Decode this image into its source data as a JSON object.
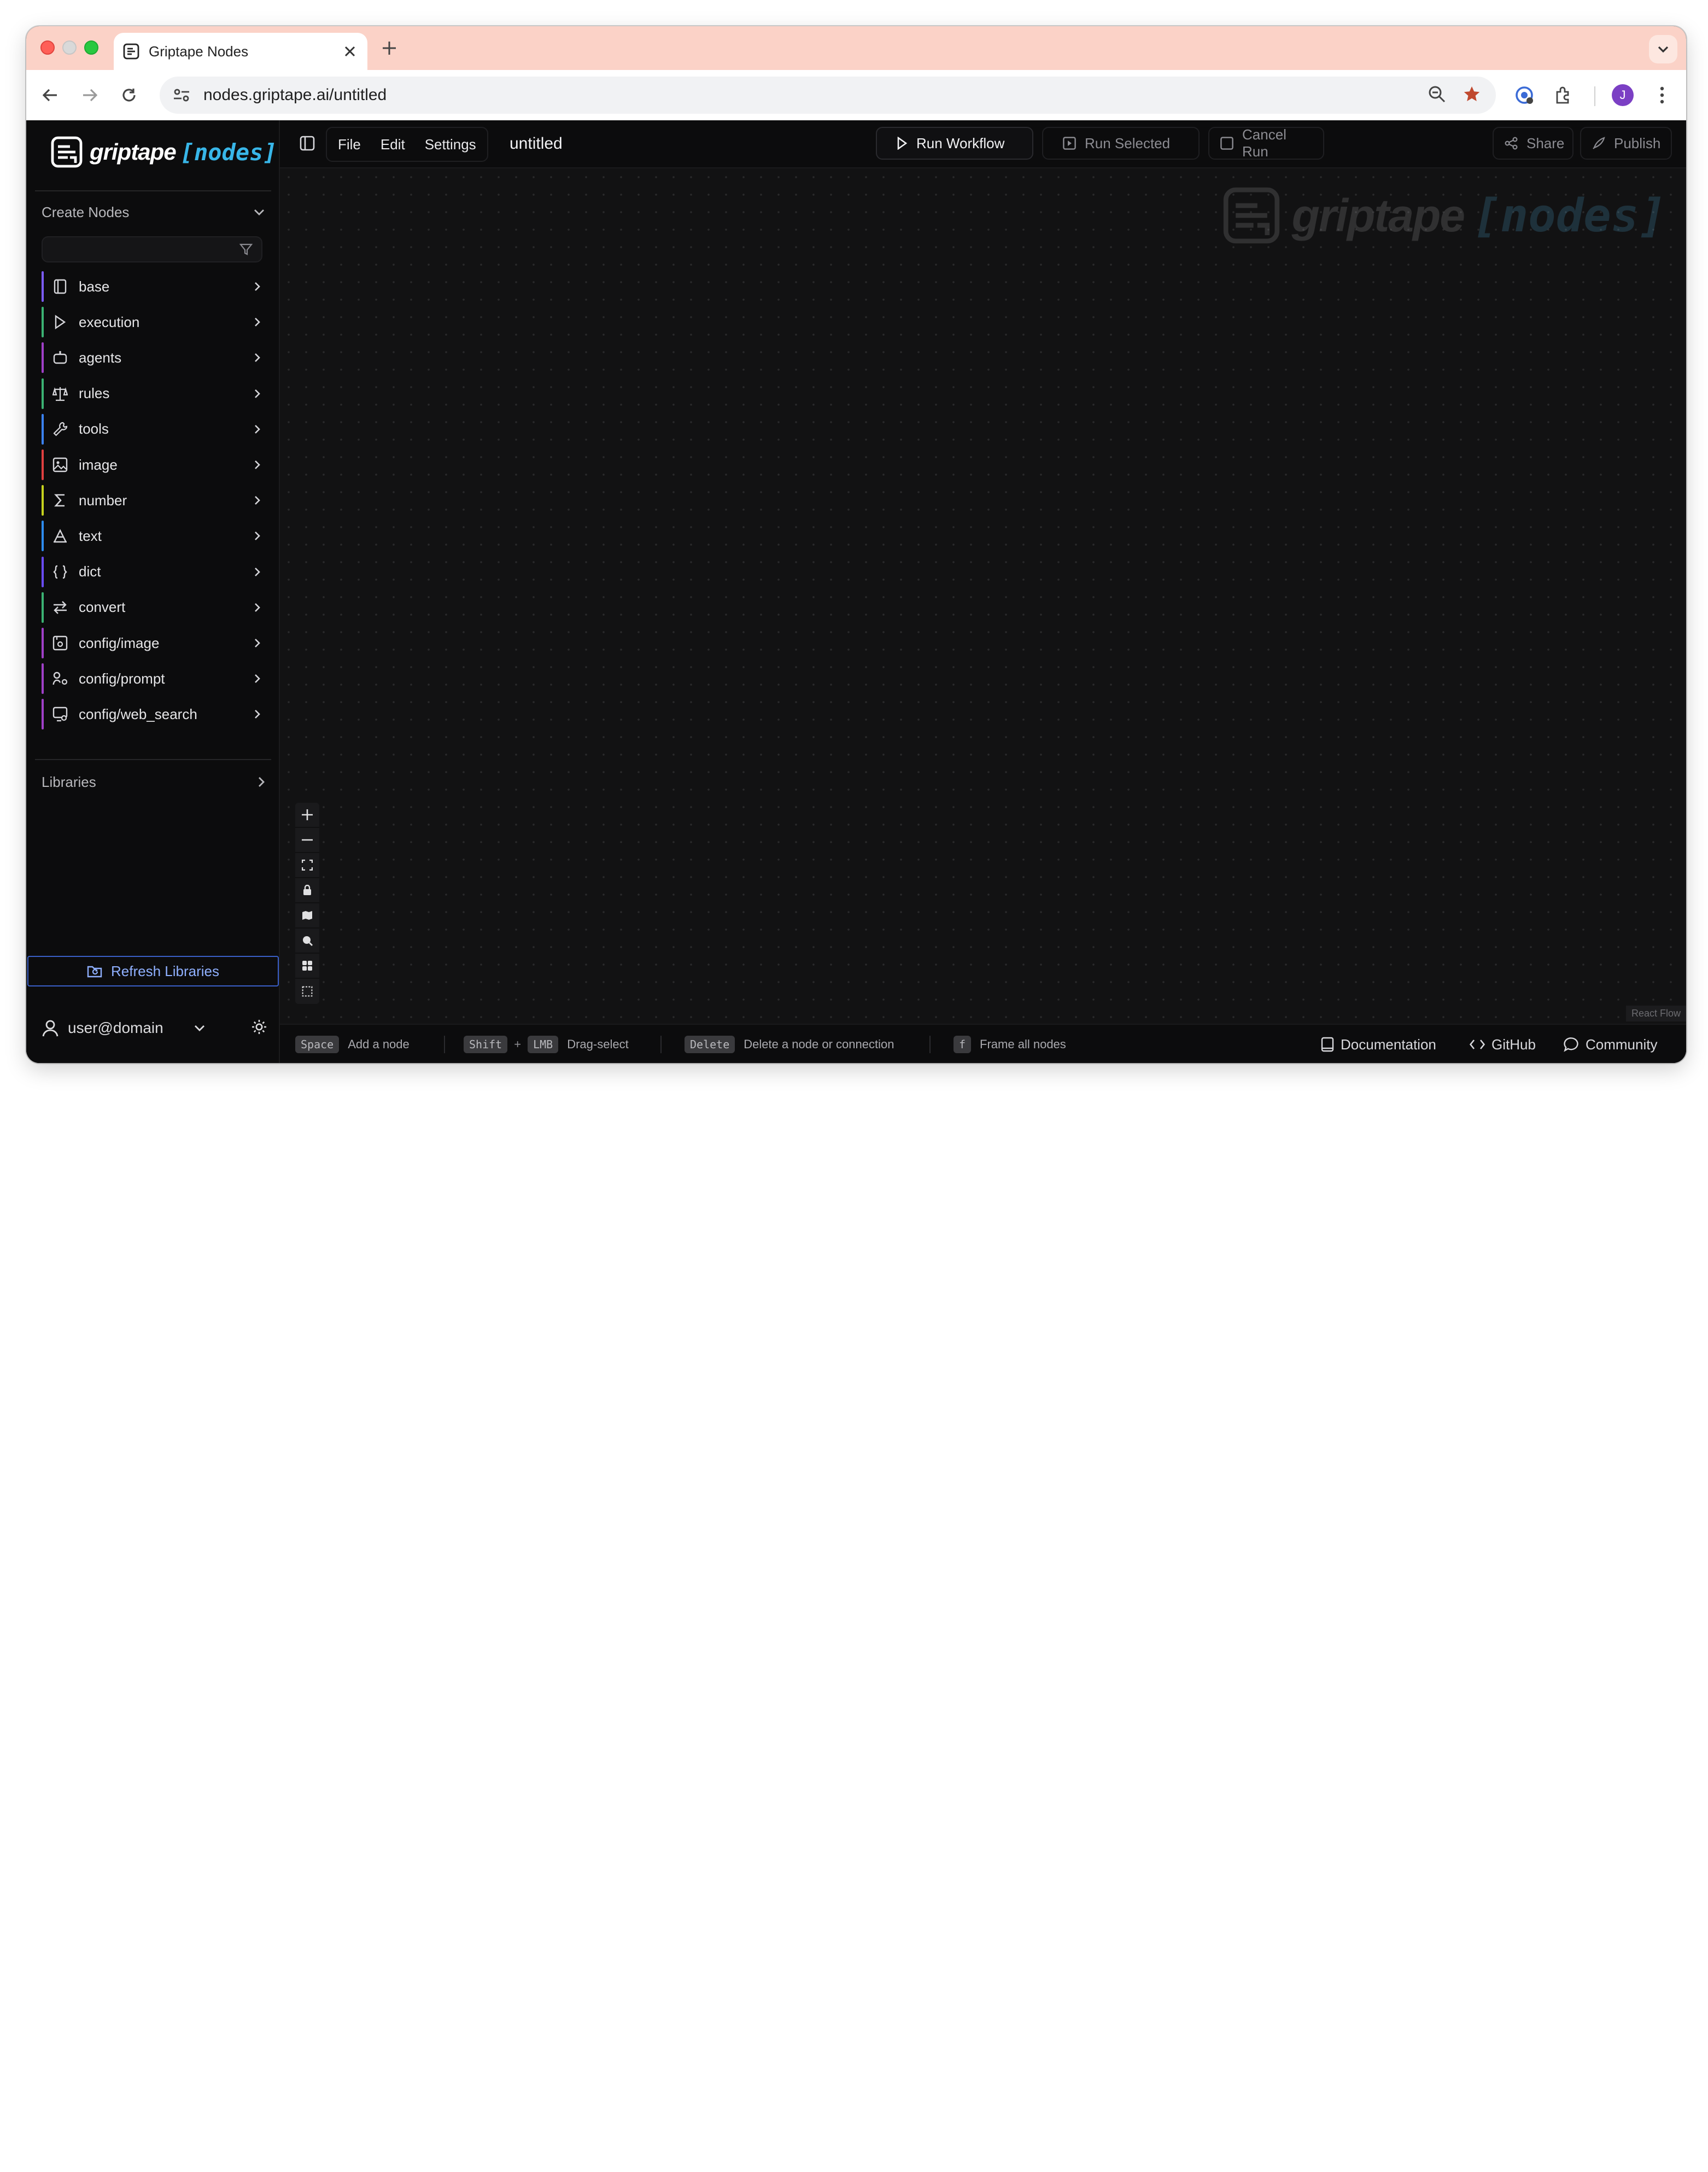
{
  "browser": {
    "tab_title": "Griptape Nodes",
    "url": "nodes.griptape.ai/untitled",
    "profile_initial": "J",
    "colors": {
      "tabstrip": "#fbd2c7",
      "star": "#c0492f",
      "avatar": "#7b3fc4"
    }
  },
  "sidebar": {
    "logo_word": "griptape",
    "logo_bracket": "[nodes]",
    "create_nodes_label": "Create Nodes",
    "filter_placeholder": "",
    "categories": [
      {
        "label": "base",
        "icon": "book-icon",
        "color": "#7c5cff"
      },
      {
        "label": "execution",
        "icon": "play-icon",
        "color": "#3bb273"
      },
      {
        "label": "agents",
        "icon": "bot-icon",
        "color": "#a040c8"
      },
      {
        "label": "rules",
        "icon": "scale-icon",
        "color": "#3bb273"
      },
      {
        "label": "tools",
        "icon": "wrench-icon",
        "color": "#3b82f6"
      },
      {
        "label": "image",
        "icon": "image-icon",
        "color": "#e04040"
      },
      {
        "label": "number",
        "icon": "sigma-icon",
        "color": "#c6d21e"
      },
      {
        "label": "text",
        "icon": "type-icon",
        "color": "#2d8cf0"
      },
      {
        "label": "dict",
        "icon": "braces-icon",
        "color": "#6a4cff"
      },
      {
        "label": "convert",
        "icon": "swap-icon",
        "color": "#3bb273"
      },
      {
        "label": "config/image",
        "icon": "image-config-icon",
        "color": "#a040c8"
      },
      {
        "label": "config/prompt",
        "icon": "prompt-config-icon",
        "color": "#a040c8"
      },
      {
        "label": "config/web_search",
        "icon": "web-search-config-icon",
        "color": "#a040c8"
      }
    ],
    "libraries_label": "Libraries",
    "refresh_label": "Refresh Libraries",
    "user_label": "user@domain"
  },
  "appbar": {
    "menus": [
      "File",
      "Edit",
      "Settings"
    ],
    "doc_title": "untitled",
    "run_workflow": "Run Workflow",
    "run_selected": "Run Selected",
    "cancel_run": "Cancel Run",
    "share": "Share",
    "publish": "Publish"
  },
  "canvas": {
    "watermark_word": "griptape",
    "watermark_bracket": "[nodes]",
    "attribution": "React Flow"
  },
  "statusbar": {
    "shortcuts": [
      {
        "keys": [
          "Space"
        ],
        "label": "Add a node"
      },
      {
        "keys": [
          "Shift",
          "LMB"
        ],
        "label": "Drag-select"
      },
      {
        "keys": [
          "Delete"
        ],
        "label": "Delete a node or connection"
      },
      {
        "keys": [
          "f"
        ],
        "label": "Frame all nodes"
      }
    ],
    "links": {
      "documentation": "Documentation",
      "github": "GitHub",
      "community": "Community"
    }
  }
}
